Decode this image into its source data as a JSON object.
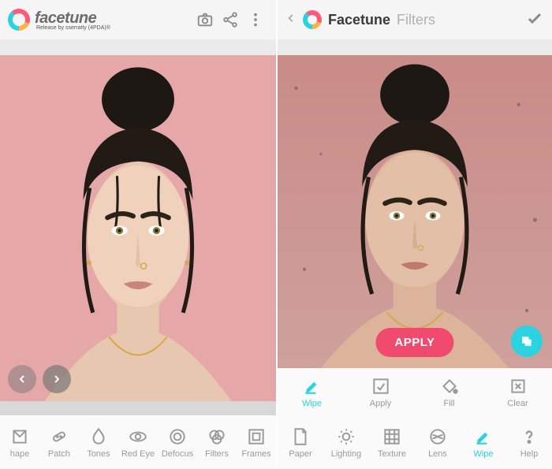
{
  "left": {
    "app_name": "facetune",
    "release_note": "Release by sserratty (4PDA)®",
    "tools": [
      {
        "id": "reshape",
        "label": "hape"
      },
      {
        "id": "patch",
        "label": "Patch"
      },
      {
        "id": "tones",
        "label": "Tones"
      },
      {
        "id": "redeye",
        "label": "Red Eye"
      },
      {
        "id": "defocus",
        "label": "Defocus"
      },
      {
        "id": "filters",
        "label": "Filters"
      },
      {
        "id": "frames",
        "label": "Frames"
      }
    ]
  },
  "right": {
    "app_title": "Facetune",
    "section": "Filters",
    "apply_label": "APPLY",
    "sub_tools": [
      {
        "id": "wipe",
        "label": "Wipe",
        "active": true
      },
      {
        "id": "apply",
        "label": "Apply"
      },
      {
        "id": "fill",
        "label": "Fill"
      },
      {
        "id": "clear",
        "label": "Clear"
      }
    ],
    "main_tools": [
      {
        "id": "paper",
        "label": "Paper"
      },
      {
        "id": "lighting",
        "label": "Lighting"
      },
      {
        "id": "texture",
        "label": "Texture"
      },
      {
        "id": "lens",
        "label": "Lens"
      },
      {
        "id": "wipe",
        "label": "Wipe",
        "active": true
      },
      {
        "id": "help",
        "label": "Help"
      }
    ]
  },
  "colors": {
    "accent": "#2bd3e0",
    "apply_bg": "#f04a6e",
    "photo_bg_left": "#e6a7a9",
    "photo_bg_right": "#cfa19c"
  }
}
